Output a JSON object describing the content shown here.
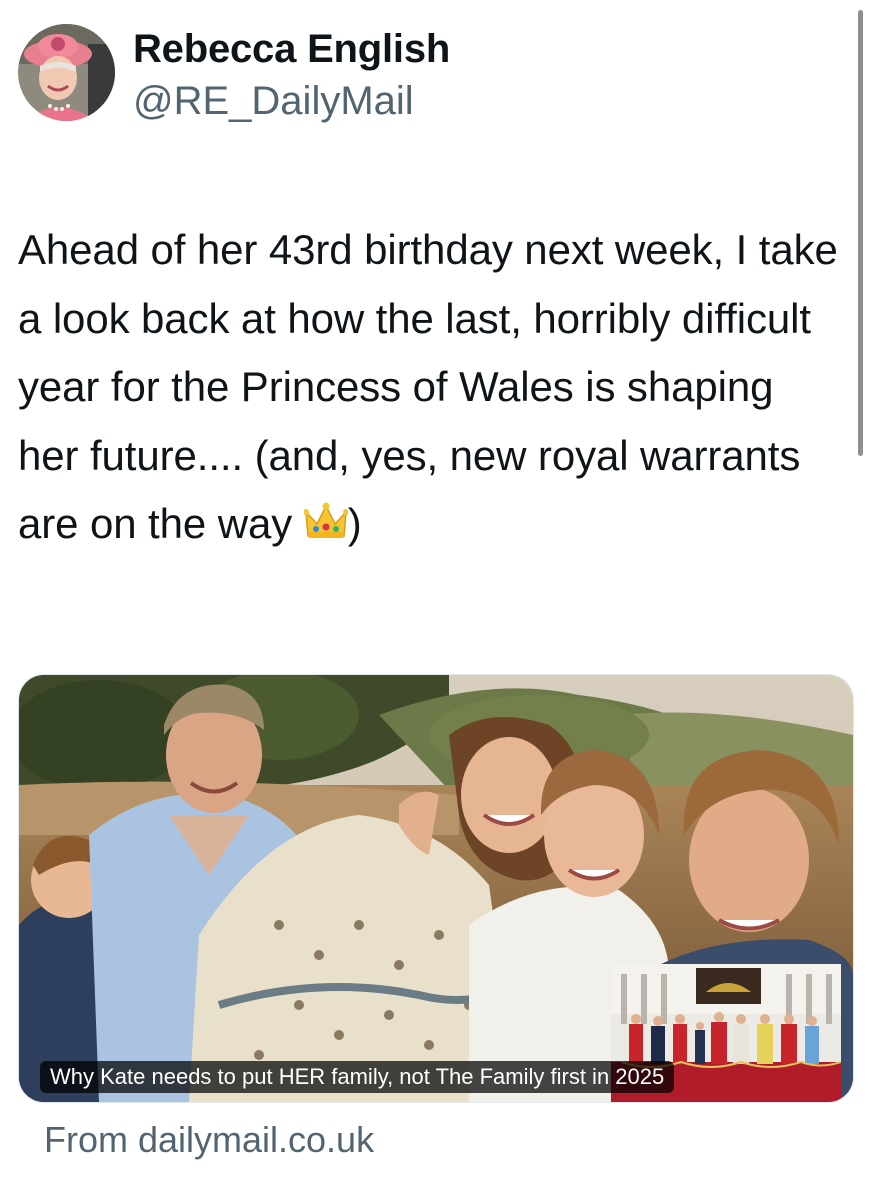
{
  "author": {
    "display_name": "Rebecca English",
    "handle": "@RE_DailyMail",
    "avatar_icon": "avatar-photo"
  },
  "tweet": {
    "text": "Ahead of her 43rd birthday next week, I take a look back at how the last, horribly difficult year for the Princess of Wales is shaping her future.... (and, yes, new royal warrants are on the way",
    "emoji_icon": "crown-emoji",
    "text_end": ")"
  },
  "link_card": {
    "image_icon": "family-photo",
    "inset_icon": "balcony-photo",
    "headline": "Why Kate needs to put HER family, not The Family first in 2025",
    "source": "From dailymail.co.uk"
  },
  "colors": {
    "text": "#0f1419",
    "secondary": "#536471",
    "card_border": "#e1e8ed"
  }
}
